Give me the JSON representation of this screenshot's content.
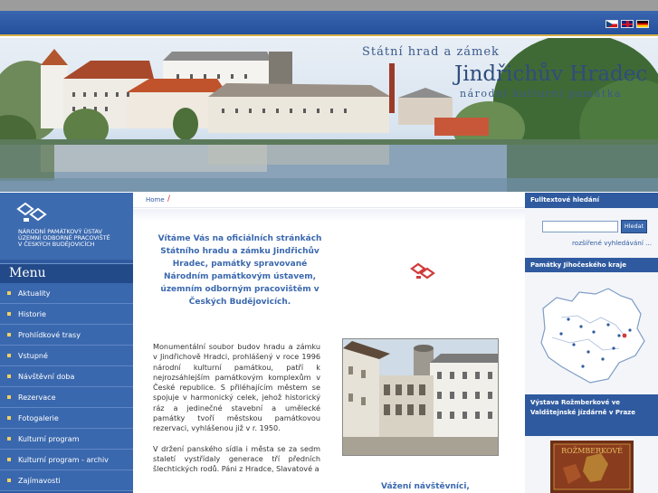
{
  "header": {
    "languages": [
      {
        "code": "cz",
        "icon": "czech-flag-icon"
      },
      {
        "code": "en",
        "icon": "uk-flag-icon"
      },
      {
        "code": "de",
        "icon": "german-flag-icon"
      }
    ]
  },
  "banner": {
    "subtitle": "Státní hrad a zámek",
    "title": "Jindřichův Hradec",
    "tagline": "národní kulturní památka"
  },
  "logo": {
    "line1": "Národní památkový ústav",
    "line2": "územní odborné pracoviště",
    "line3": "v Českých Budějovicích"
  },
  "menu": {
    "title": "Menu",
    "items": [
      {
        "label": "Aktuality"
      },
      {
        "label": "Historie"
      },
      {
        "label": "Prohlídkové trasy"
      },
      {
        "label": "Vstupné"
      },
      {
        "label": "Návštěvní doba"
      },
      {
        "label": "Rezervace"
      },
      {
        "label": "Fotogalerie"
      },
      {
        "label": "Kulturní program"
      },
      {
        "label": "Kulturní program - archiv"
      },
      {
        "label": "Zajímavosti"
      }
    ]
  },
  "breadcrumb": {
    "home": "Home",
    "separator": "/"
  },
  "main": {
    "welcome": "Vítáme Vás na oficiálních stránkách Státního hradu a zámku Jindřichův Hradec, památky spravované Národním památkovým ústavem, územním odborným pracovištěm v Českých Budějovicích.",
    "paragraph1": "Monumentální soubor budov hradu a zámku v Jindřichově Hradci, prohlášený v roce 1996 národní kulturní památkou, patří k nejrozsáhlejším památkovým komplexům v České republice. S přiléhajícím městem se spojuje v harmonický celek, jehož historický ráz a jedinečné stavební a umělecké památky tvoří městskou památkovou rezervaci, vyhlášenou již v r. 1950.",
    "paragraph2": "V držení panského sídla i města se za sedm staletí vystřídaly generace tří předních šlechtických rodů. Páni z Hradce, Slavatové a",
    "greeting": "Vážení návštěvníci,"
  },
  "sidebar_right": {
    "search_title": "Fulltextové hledání",
    "search_value": "",
    "search_button": "Hledat",
    "advanced_search": "rozšířené vyhledávání ...",
    "monuments_title": "Památky Jihočeského kraje",
    "exhibition_title": "Výstava Rožmberkové ve Valdštejnské jízdárně v Praze",
    "exhibition_image_text": "ROŽMBERKOVÉ"
  },
  "colors": {
    "brand_blue": "#2f5a9f",
    "menu_blue": "#3a68ae",
    "accent_gold": "#d4b04a",
    "logo_red": "#d23a3a"
  }
}
